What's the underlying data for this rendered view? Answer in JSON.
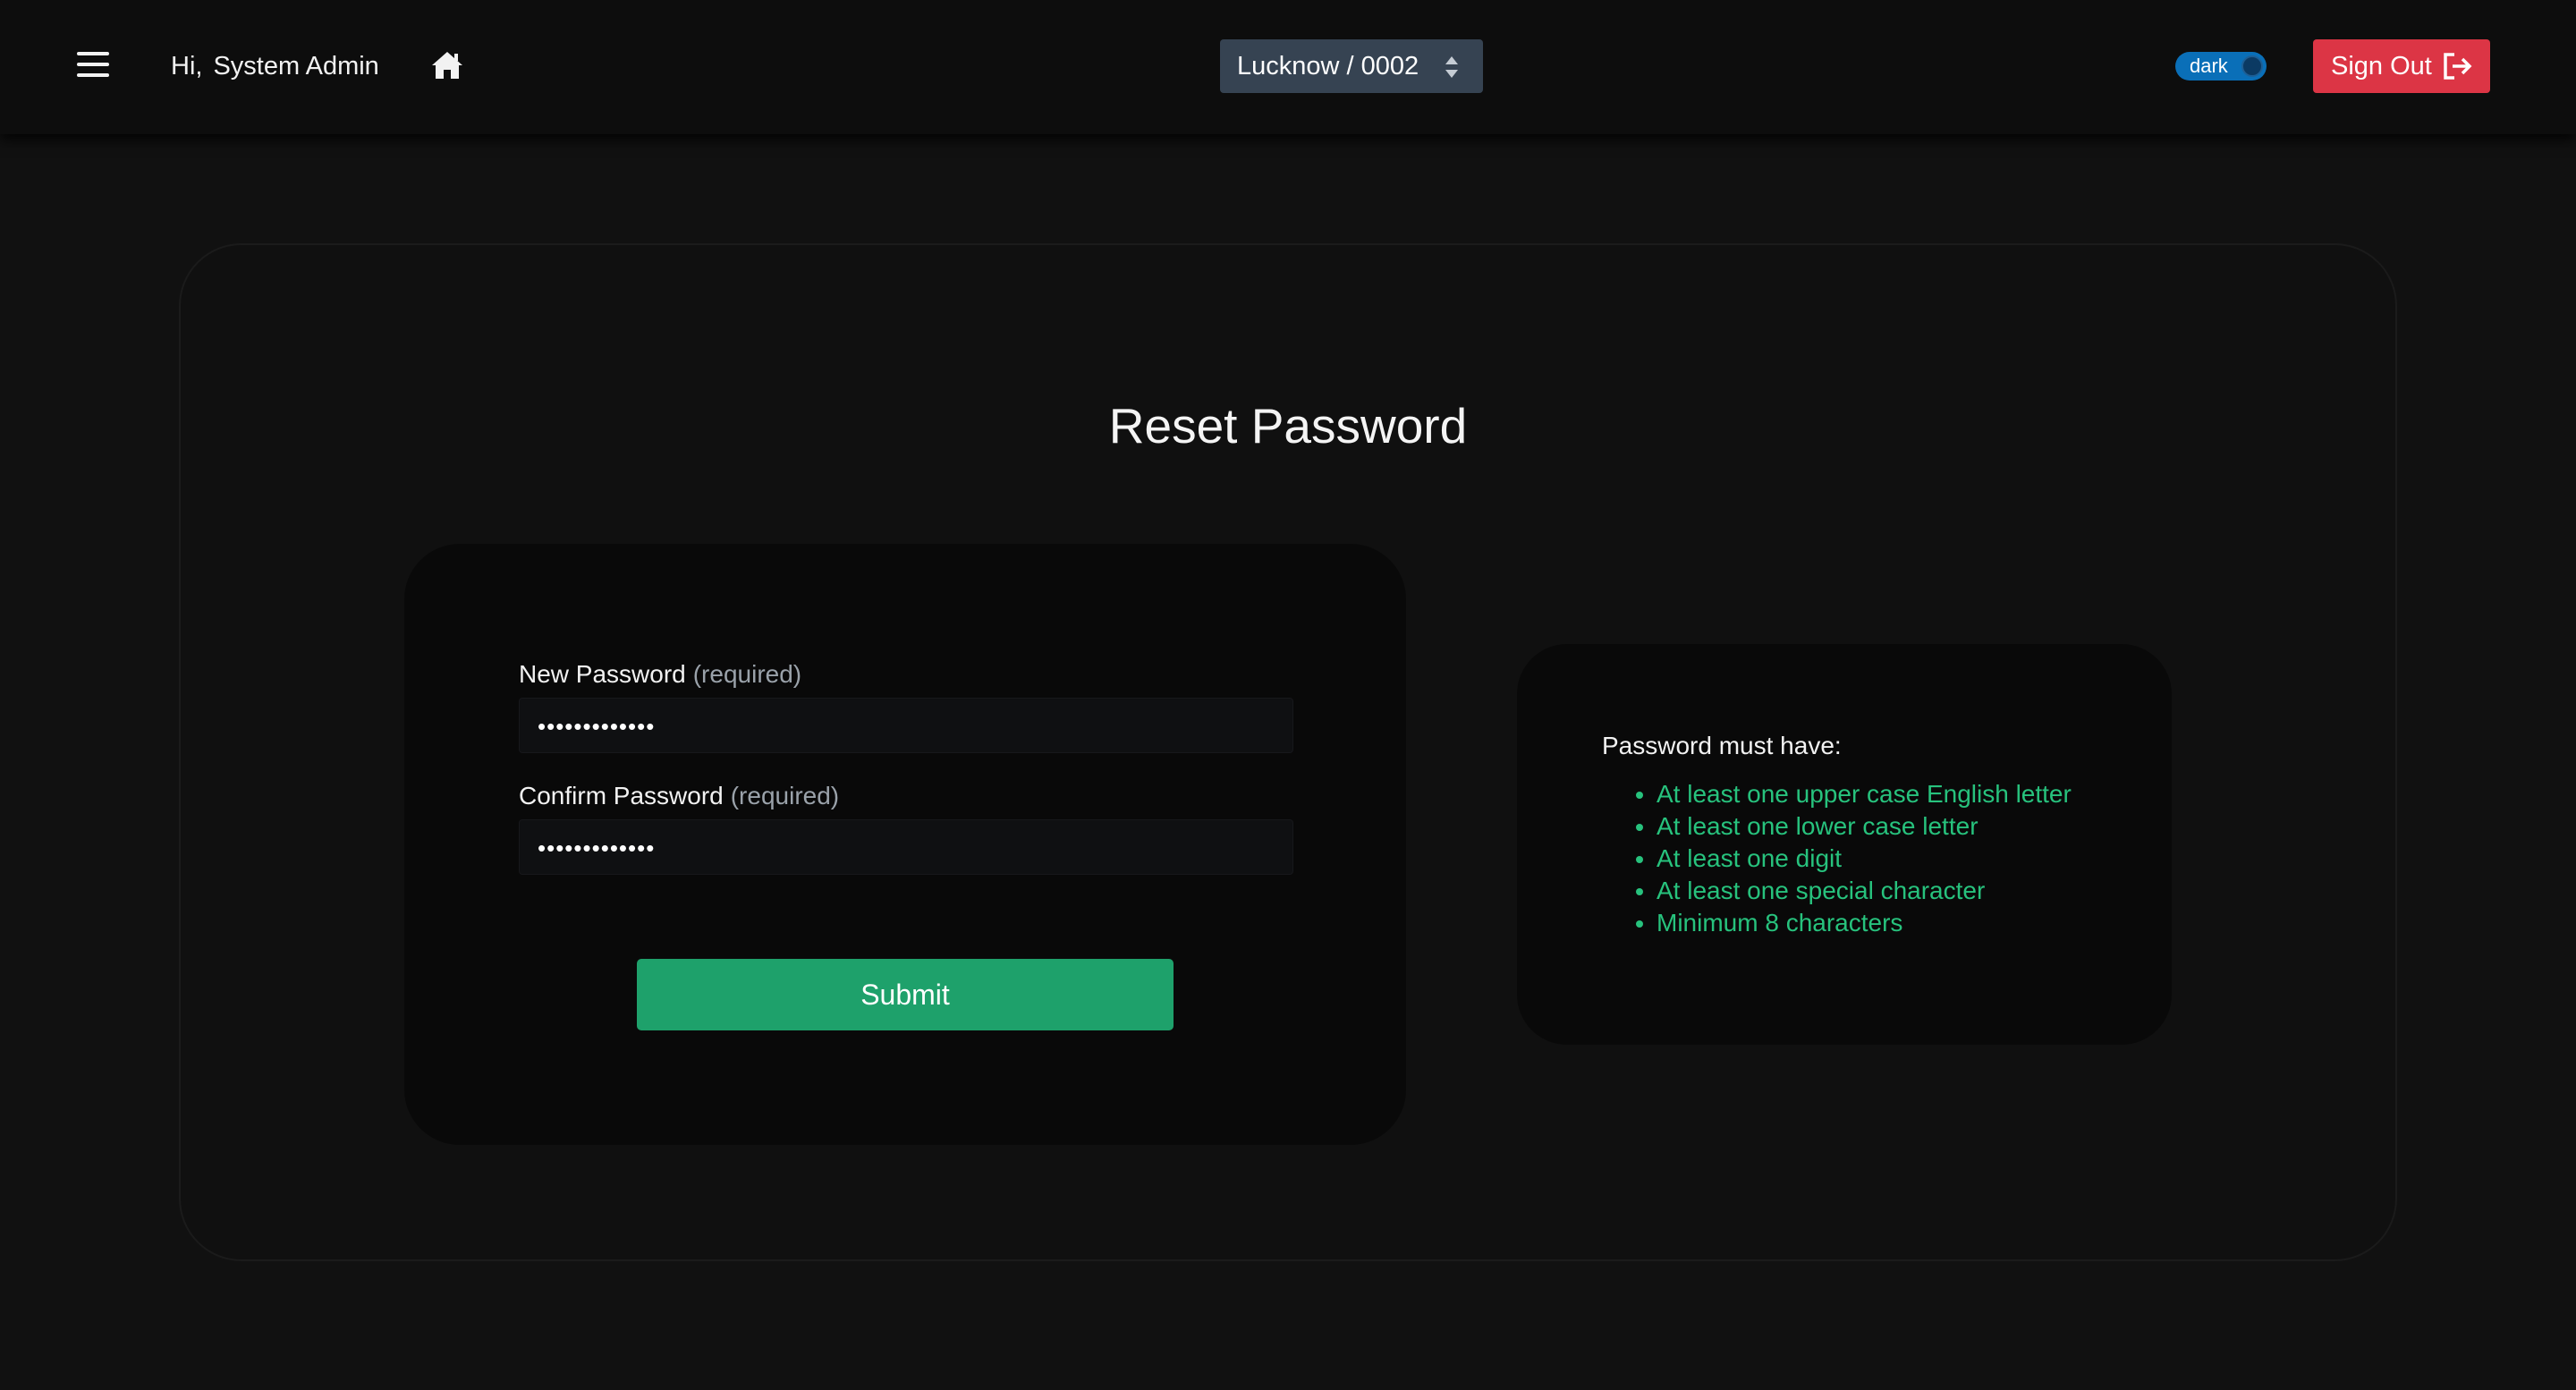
{
  "header": {
    "greeting_prefix": "Hi,",
    "user_name": "System Admin",
    "branch_selector": "Lucknow / 0002",
    "theme_toggle_label": "dark",
    "sign_out_label": "Sign Out"
  },
  "page": {
    "title": "Reset Password"
  },
  "form": {
    "new_password": {
      "label": "New Password",
      "hint": "(required)",
      "value": "•••••••••••••"
    },
    "confirm_password": {
      "label": "Confirm Password",
      "hint": "(required)",
      "value": "•••••••••••••"
    },
    "submit_label": "Submit"
  },
  "requirements": {
    "heading": "Password must have:",
    "items": [
      "At least one upper case English letter",
      "At least one lower case letter",
      "At least one digit",
      "At least one special character",
      "Minimum 8 characters"
    ]
  },
  "colors": {
    "background": "#111111",
    "header": "#0d0d0d",
    "branch_selector": "#364352",
    "toggle": "#0a6fb8",
    "sign_out": "#dc3545",
    "submit": "#1ea16b",
    "requirement_text": "#27c27d"
  },
  "icons": {
    "menu": "hamburger-menu-icon",
    "home": "home-icon",
    "select_caret": "chevron-up-down-icon",
    "sign_out": "sign-out-icon"
  }
}
